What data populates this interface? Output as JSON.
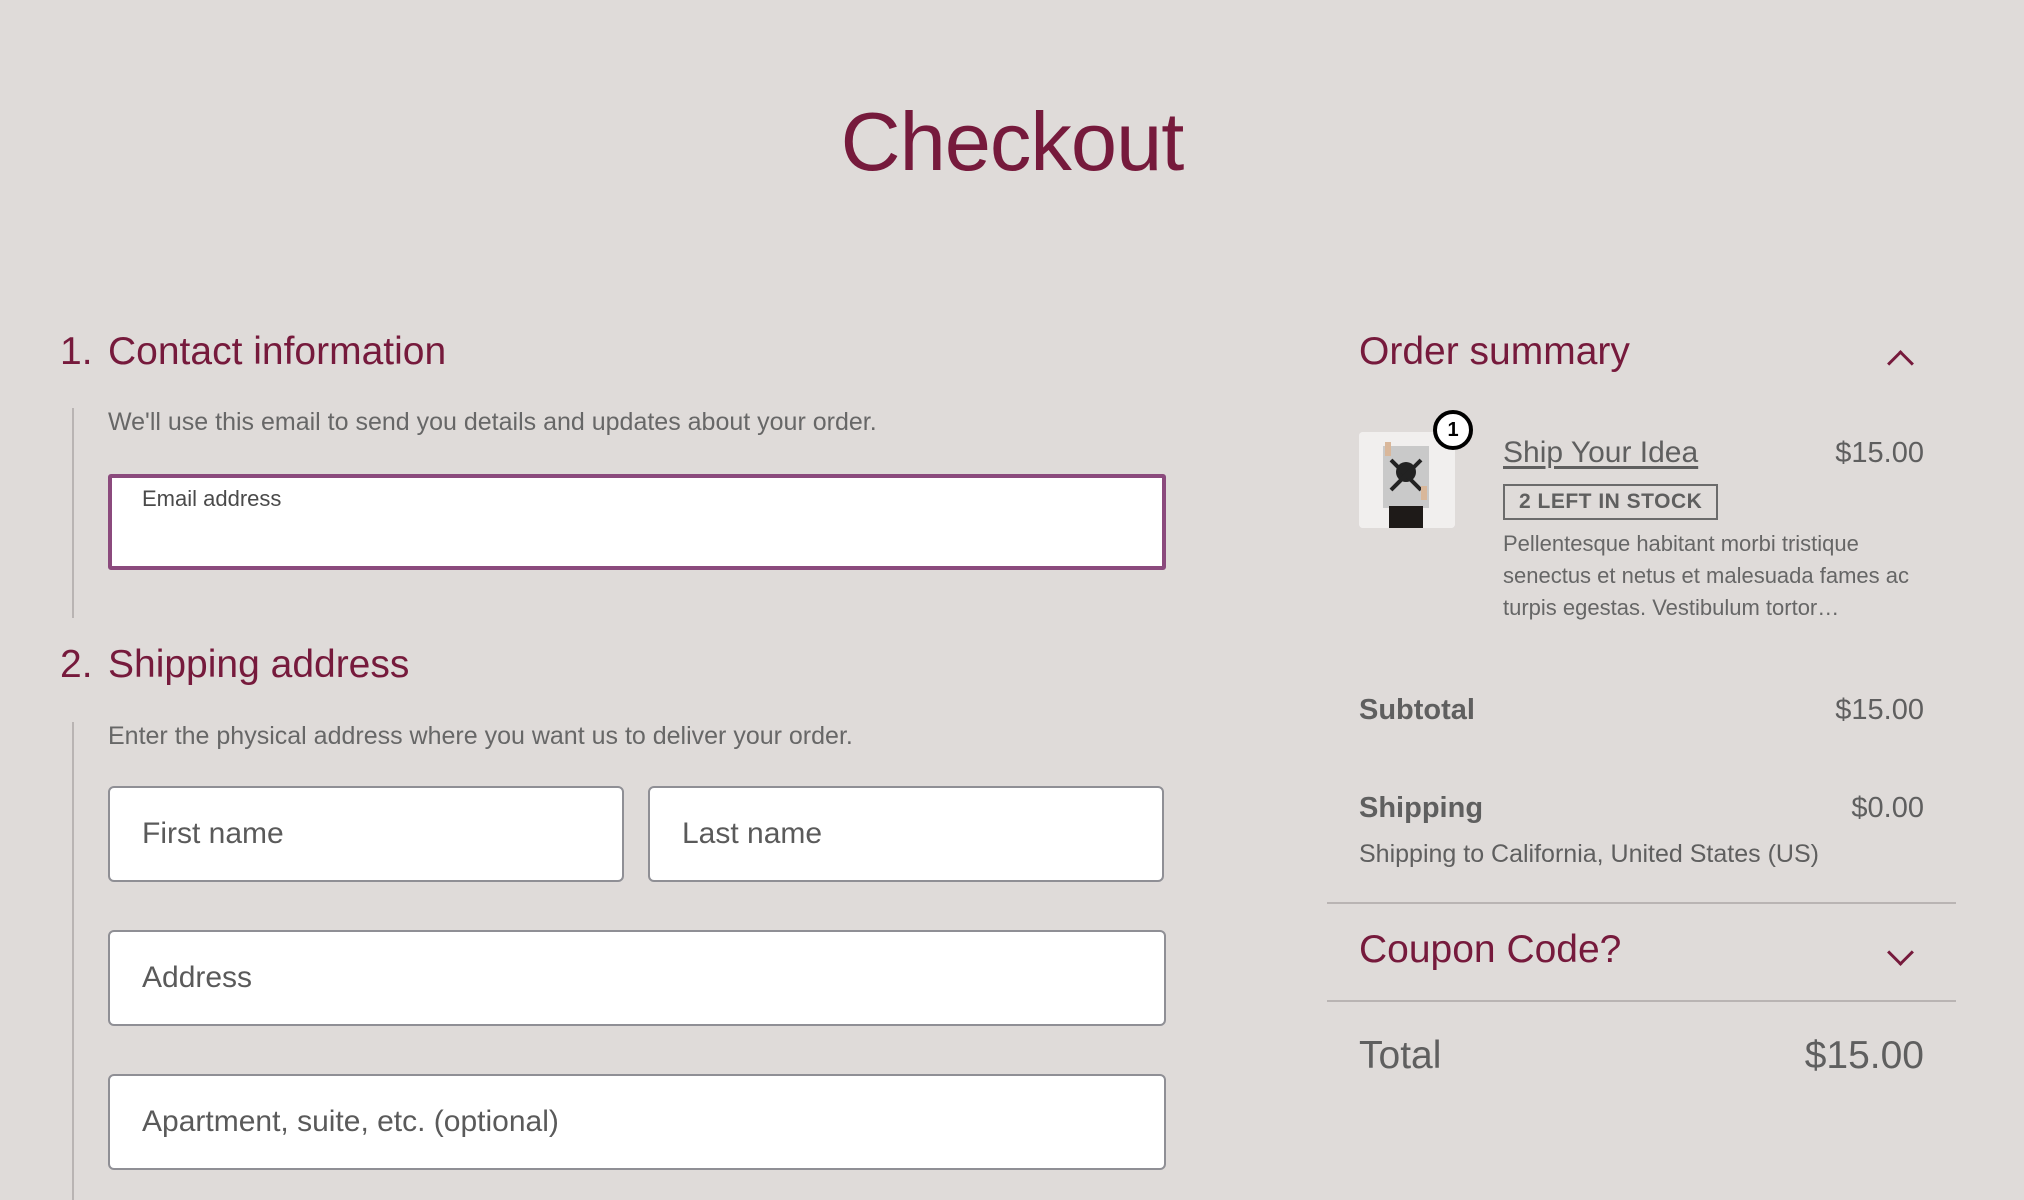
{
  "page": {
    "title": "Checkout"
  },
  "contact": {
    "number": "1.",
    "heading": "Contact information",
    "description": "We'll use this email to send you details and updates about your order.",
    "email_label": "Email address",
    "email_value": ""
  },
  "shipping": {
    "number": "2.",
    "heading": "Shipping address",
    "description": "Enter the physical address where you want us to deliver your order.",
    "first_name_placeholder": "First name",
    "last_name_placeholder": "Last name",
    "address_placeholder": "Address",
    "apartment_placeholder": "Apartment, suite, etc. (optional)"
  },
  "summary": {
    "heading": "Order summary",
    "item": {
      "quantity": "1",
      "name": "Ship Your Idea",
      "price": "$15.00",
      "stock_badge": "2 LEFT IN STOCK",
      "description": "Pellentesque habitant morbi tristique senectus et netus et malesuada fames ac turpis egestas. Vestibulum tortor…"
    },
    "subtotal_label": "Subtotal",
    "subtotal_value": "$15.00",
    "shipping_label": "Shipping",
    "shipping_value": "$0.00",
    "shipping_note": "Shipping to California, United States (US)",
    "coupon_label": "Coupon Code?",
    "total_label": "Total",
    "total_value": "$15.00"
  },
  "colors": {
    "accent": "#761a3c",
    "background": "#dfdbd9",
    "focus_border": "#8b4a7d"
  }
}
